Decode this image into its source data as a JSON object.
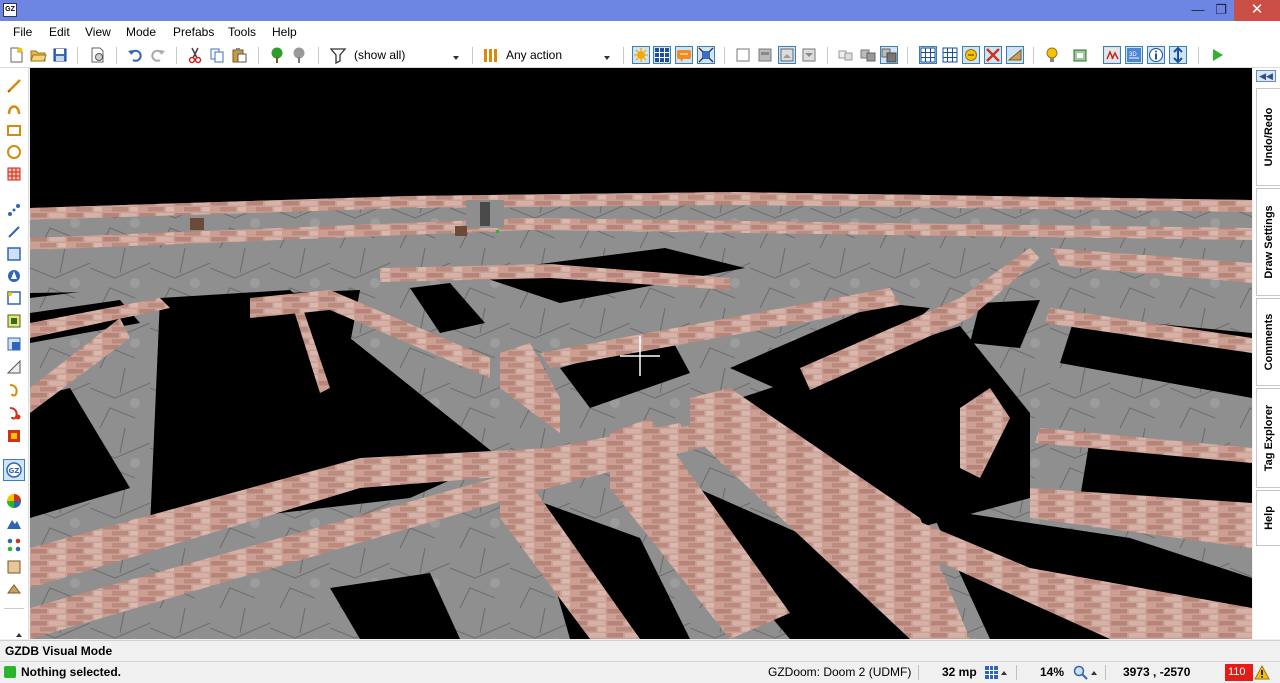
{
  "window": {
    "icon_text": "GZ",
    "minimize": "—",
    "restore": "❐",
    "close": "✕"
  },
  "menu": [
    "File",
    "Edit",
    "View",
    "Mode",
    "Prefabs",
    "Tools",
    "Help"
  ],
  "toolbar": {
    "filter_value": "(show all)",
    "action_value": "Any action"
  },
  "dock_tabs": [
    "Undo/Redo",
    "Draw Settings",
    "Comments",
    "Tag Explorer",
    "Help"
  ],
  "dock_collapse": "◀◀",
  "mode_label": "GZDB Visual Mode",
  "status": {
    "message": "Nothing selected.",
    "engine": "GZDoom: Doom 2 (UDMF)",
    "grid": "32 mp",
    "zoom": "14%",
    "coords": "3973 , -2570",
    "warnings": "110"
  },
  "colors": {
    "titlebar": "#6e86e3",
    "close": "#c94e46",
    "warning": "#e41b17",
    "ok": "#2bb52b",
    "highlight": "#cfe4f7"
  }
}
